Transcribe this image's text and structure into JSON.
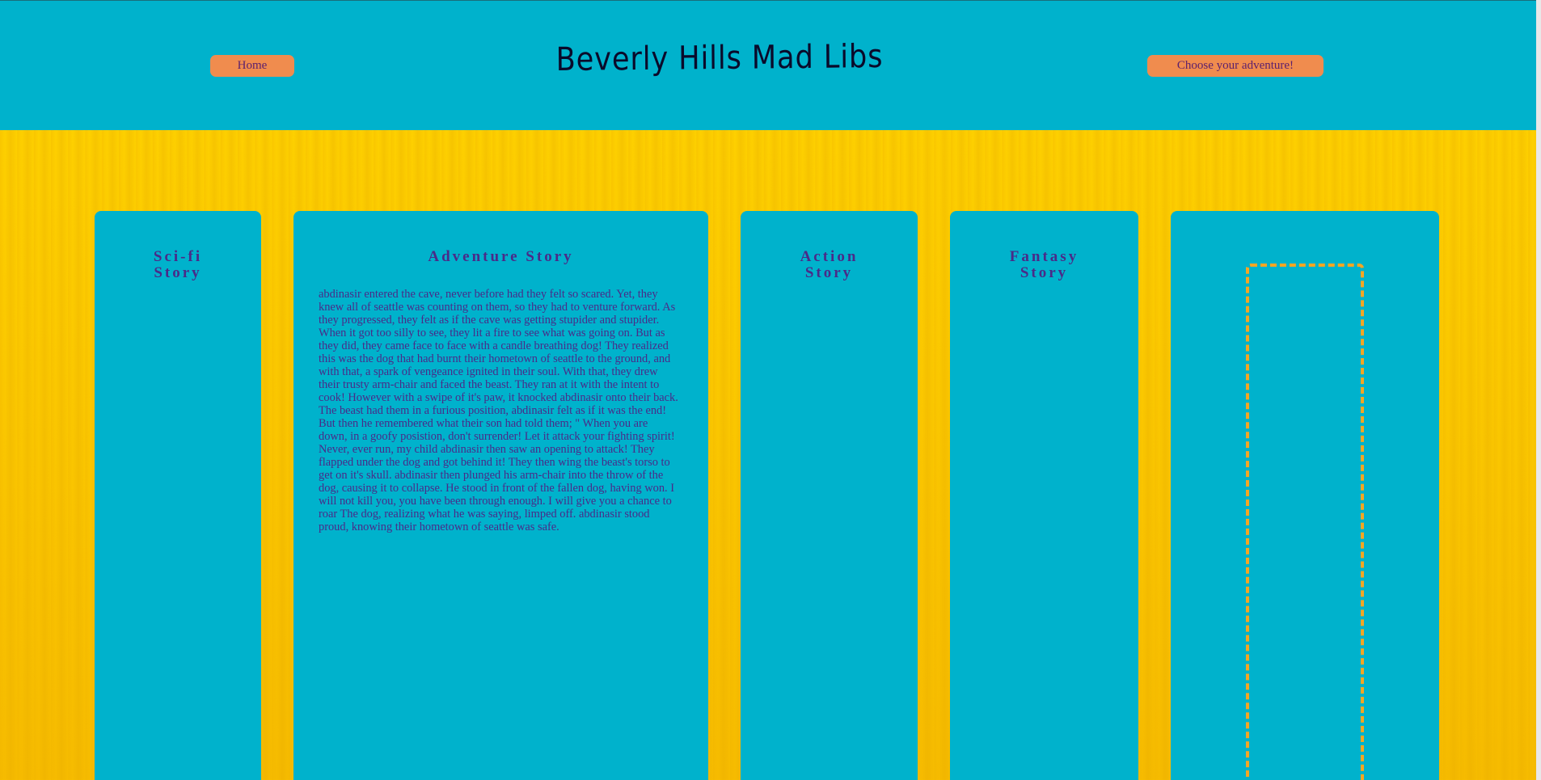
{
  "header": {
    "title": "Beverly Hills Mad Libs",
    "home_label": "Home",
    "adventure_label": "Choose your adventure!"
  },
  "cards": {
    "scifi": {
      "title": "Sci-fi Story"
    },
    "adventure": {
      "title": "Adventure Story",
      "story": "abdinasir entered the cave, never before had they felt so scared. Yet, they knew all of seattle was counting on them, so they had to venture forward. As they progressed, they felt as if the cave was getting stupider and stupider. When it got too silly to see, they lit a fire to see what was going on. But as they did, they came face to face with a candle breathing dog! They realized this was the dog that had burnt their hometown of seattle to the ground, and with that, a spark of vengeance ignited in their soul. With that, they drew their trusty arm-chair and faced the beast. They ran at it with the intent to cook! However with a swipe of it's paw, it knocked abdinasir onto their back. The beast had them in a furious position, abdinasir felt as if it was the end! But then he remembered what their son had told them; \" When you are down, in a goofy posistion, don't surrender! Let it attack your fighting spirit! Never, ever run, my child abdinasir then saw an opening to attack! They flapped under the dog and got behind it! They then wing the beast's torso to get on it's skull. abdinasir then plunged his arm-chair into the throw of the dog, causing it to collapse. He stood in front of the fallen dog, having won. I will not kill you, you have been through enough. I will give you a chance to roar The dog, realizing what he was saying, limped off. abdinasir stood proud, knowing their hometown of seattle was safe."
    },
    "action": {
      "title": "Action Story"
    },
    "fantasy": {
      "title": "Fantasy Story"
    }
  },
  "colors": {
    "header_bg": "#00b2cc",
    "button_bg": "#f08c4e",
    "card_bg": "#00b2cc",
    "text": "#4a2a88",
    "drop_border": "#f5a623",
    "page_bg": "#fccf00"
  }
}
